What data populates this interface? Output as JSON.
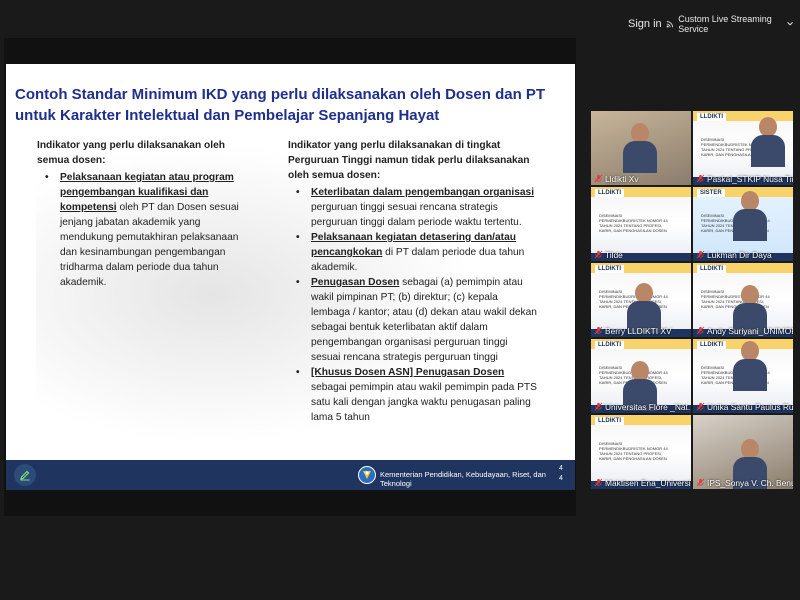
{
  "topbar": {
    "sign_in": "Sign in",
    "stream_label": "Custom Live Streaming Service"
  },
  "slide": {
    "title": "Contoh Standar Minimum IKD yang perlu dilaksanakan oleh Dosen dan PT untuk Karakter Intelektual dan Pembelajar Sepanjang Hayat",
    "left": {
      "heading": "Indikator yang perlu dilaksanakan oleh semua dosen:",
      "items": [
        {
          "lead": "Pelaksanaan kegiatan atau program pengembangan kualifikasi dan kompetensi",
          "rest": " oleh PT dan Dosen sesuai jenjang jabatan akademik yang mendukung pemutakhiran pelaksanaan dan kesinambungan pengembangan tridharma dalam periode dua tahun akademik."
        }
      ]
    },
    "right": {
      "heading": "Indikator yang perlu dilaksanakan di tingkat Perguruan Tinggi namun tidak perlu dilaksanakan oleh semua dosen:",
      "items": [
        {
          "lead": "Keterlibatan dalam pengembangan organisasi",
          "rest": " perguruan tinggi sesuai rencana strategis perguruan tinggi dalam periode waktu tertentu."
        },
        {
          "lead": "Pelaksanaan kegiatan detasering dan/atau pencangkokan",
          "rest": " di PT dalam periode dua tahun akademik."
        },
        {
          "lead": "Penugasan Dosen",
          "rest": " sebagai (a) pemimpin atau wakil pimpinan PT; (b) direktur; (c) kepala lembaga / kantor; atau (d) dekan atau wakil dekan sebagai bentuk keterlibatan aktif dalam pengembangan organisasi perguruan tinggi sesuai rencana strategis perguruan tinggi"
        },
        {
          "lead": "[Khusus Dosen ASN] Penugasan Dosen",
          "rest": " sebagai pemimpin atau wakil pemimpin pada PTS satu kali dengan jangka waktu penugasan paling lama 5 tahun"
        }
      ]
    },
    "footer": {
      "ministry": "Kementerian Pendidikan, Kebudayaan, Riset, dan Teknologi",
      "page_a": "4",
      "page_b": "4"
    }
  },
  "participants": [
    {
      "name": "Lldikti Xv",
      "icon": "mic-muted-icon"
    },
    {
      "name": "Paskal_STKIP Nusa Tim...",
      "icon": "mic-muted-icon"
    },
    {
      "name": "Tilde",
      "icon": "mic-muted-icon"
    },
    {
      "name": "Lukman Dir Daya",
      "icon": "mic-muted-icon"
    },
    {
      "name": "Berry LLDIKTI XV",
      "icon": "mic-muted-icon"
    },
    {
      "name": "Andy Suriyani_UNIMOF",
      "icon": "mic-muted-icon"
    },
    {
      "name": "Universitas Flore _Nat...",
      "icon": "mic-muted-icon"
    },
    {
      "name": "Unika Santu Paulus Ru...",
      "icon": "mic-muted-icon"
    },
    {
      "name": "Maktisen Ena_Universi...",
      "icon": "mic-muted-icon"
    },
    {
      "name": "IPS_Sonya V. Ch. Benu",
      "icon": "mic-muted-icon"
    }
  ],
  "tile_logo_text": "LLDIKTI",
  "tile_slide_text": "DISEMINASI PERMENDIKBUDRISTEK NOMOR 44 TAHUN 2024 TENTANG PROFESI, KARIR, DAN PENGHASILAN DOSEN",
  "tile_sister_text": "SISTER",
  "colors": {
    "title_blue": "#1f2f8c",
    "footer_navy": "#1f3560",
    "active_speaker": "#4bd04b",
    "muted_red": "#e23b3b"
  }
}
